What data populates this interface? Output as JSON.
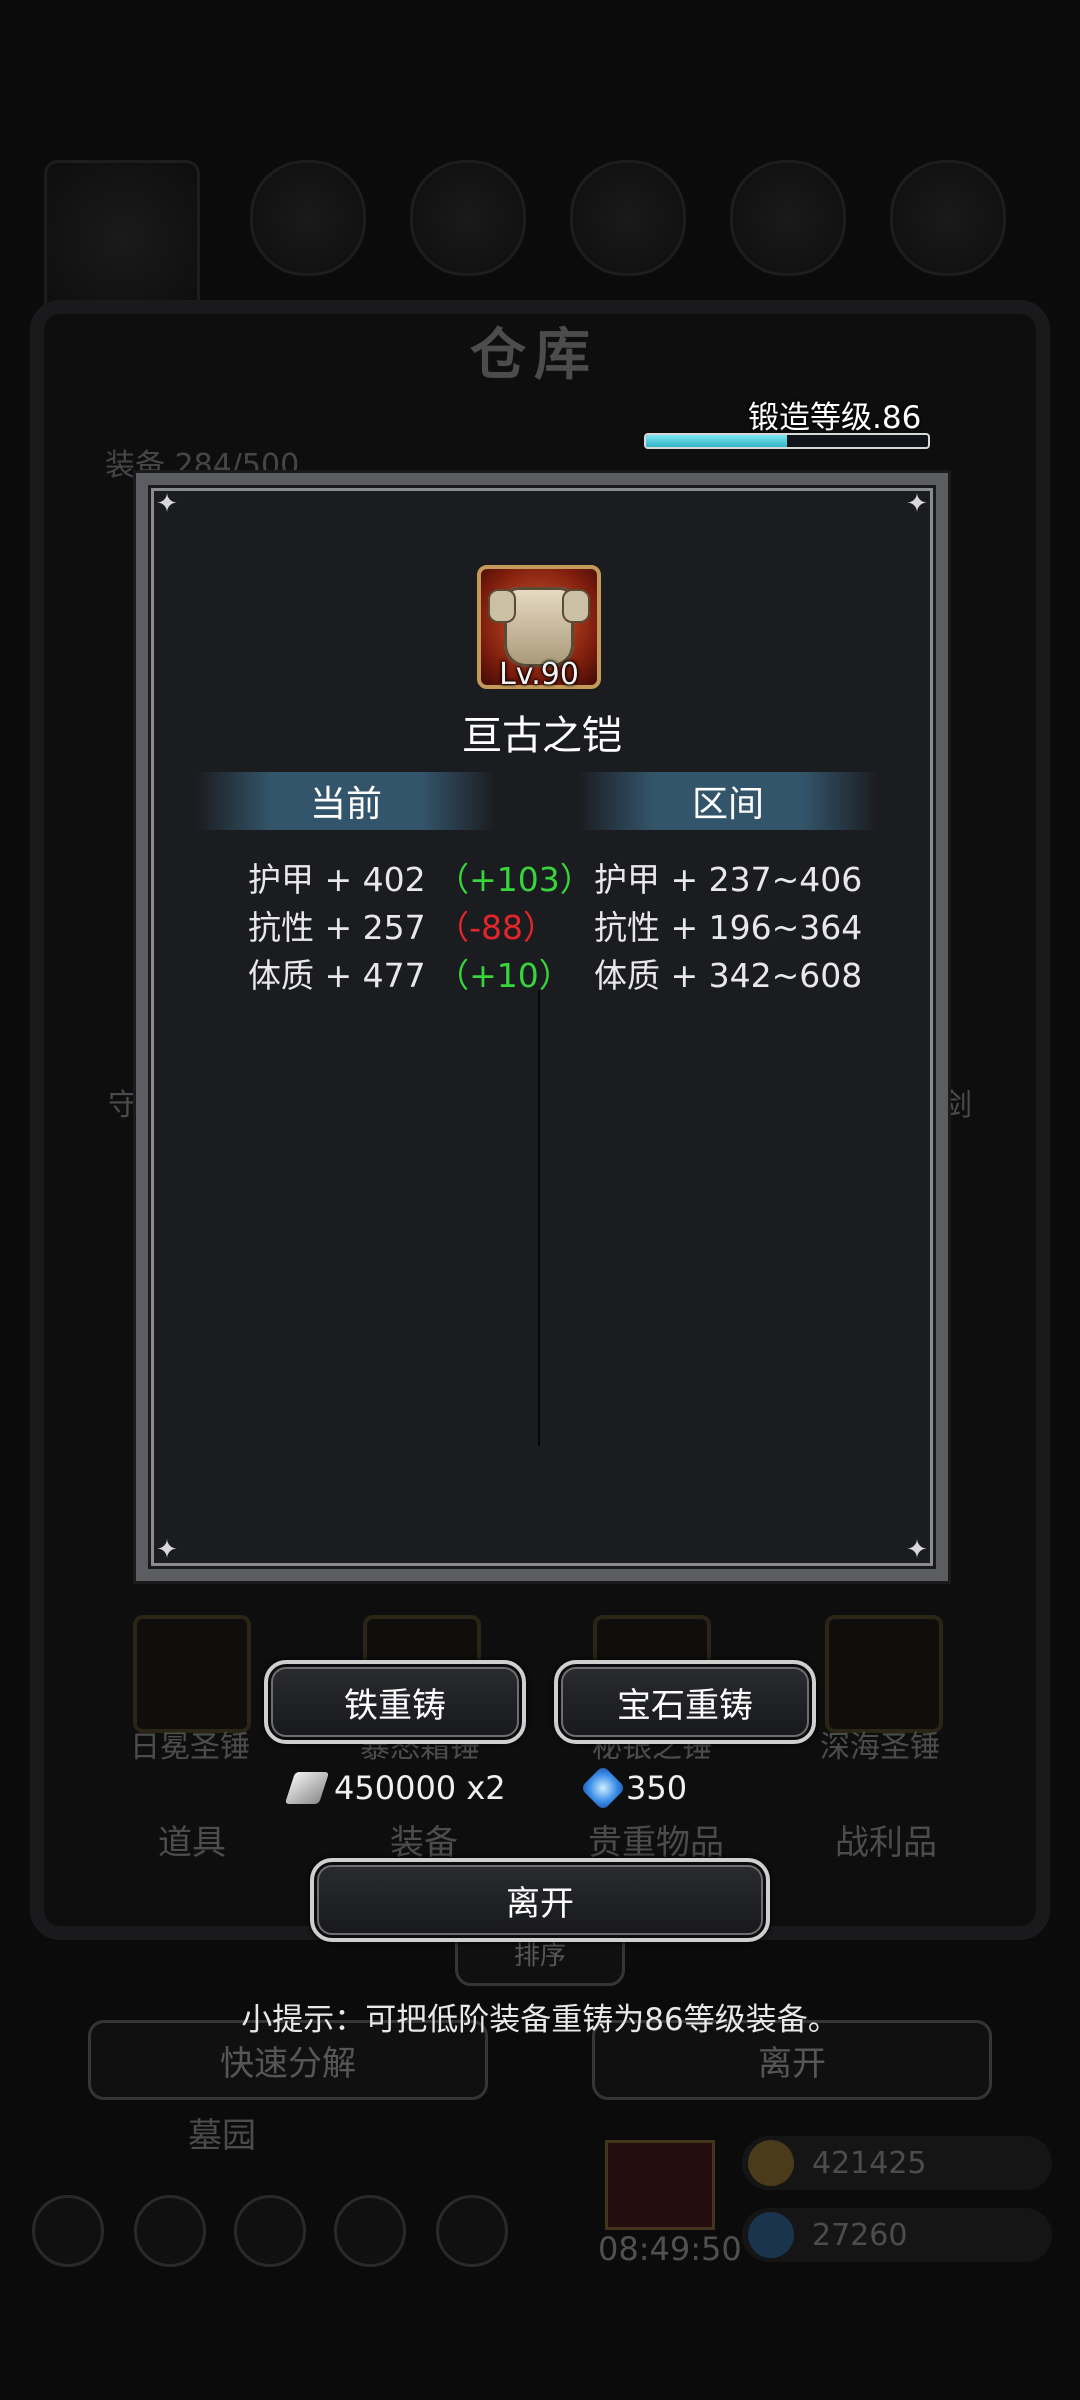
{
  "background": {
    "title": "仓库",
    "equipment_count": "装备  284/500",
    "left_labels": [
      "守"
    ],
    "right_labels": [
      "剑"
    ],
    "hammers": [
      {
        "label": "日冕圣锤"
      },
      {
        "label": "暴怒霜锤"
      },
      {
        "label": "秘银之锤"
      },
      {
        "label": "深海圣锤"
      }
    ],
    "tabs": [
      "道具",
      "装备",
      "贵重物品",
      "战利品"
    ],
    "sort_label": "排序",
    "quick_decompose": "快速分解",
    "leave": "离开",
    "graveyard": "墓园",
    "gold": "421425",
    "gems": "27260",
    "timer": "08:49:50"
  },
  "forge": {
    "label": "锻造等级.86",
    "progress": 0.5
  },
  "item": {
    "level": "Lv.90",
    "name": "亘古之铠",
    "icon": "armor-icon"
  },
  "columns": {
    "current": "当前",
    "range": "区间"
  },
  "stats": [
    {
      "label": "护甲 + 402",
      "diff": "（+103）",
      "diff_type": "positive",
      "range": "护甲 + 237~406"
    },
    {
      "label": "抗性 + 257",
      "diff": "（-88）",
      "diff_type": "negative",
      "range": "抗性 + 196~364"
    },
    {
      "label": "体质 + 477",
      "diff": "（+10）",
      "diff_type": "positive",
      "range": "体质 + 342~608"
    }
  ],
  "buttons": {
    "iron_recast": "铁重铸",
    "gem_recast": "宝石重铸",
    "leave": "离开"
  },
  "costs": {
    "iron": "450000 x2",
    "gem": "350"
  },
  "hint": "小提示：可把低阶装备重铸为86等级装备。",
  "colors": {
    "positive": "#38d43c",
    "negative": "#e0262a",
    "progress": "#2fb5c9"
  }
}
